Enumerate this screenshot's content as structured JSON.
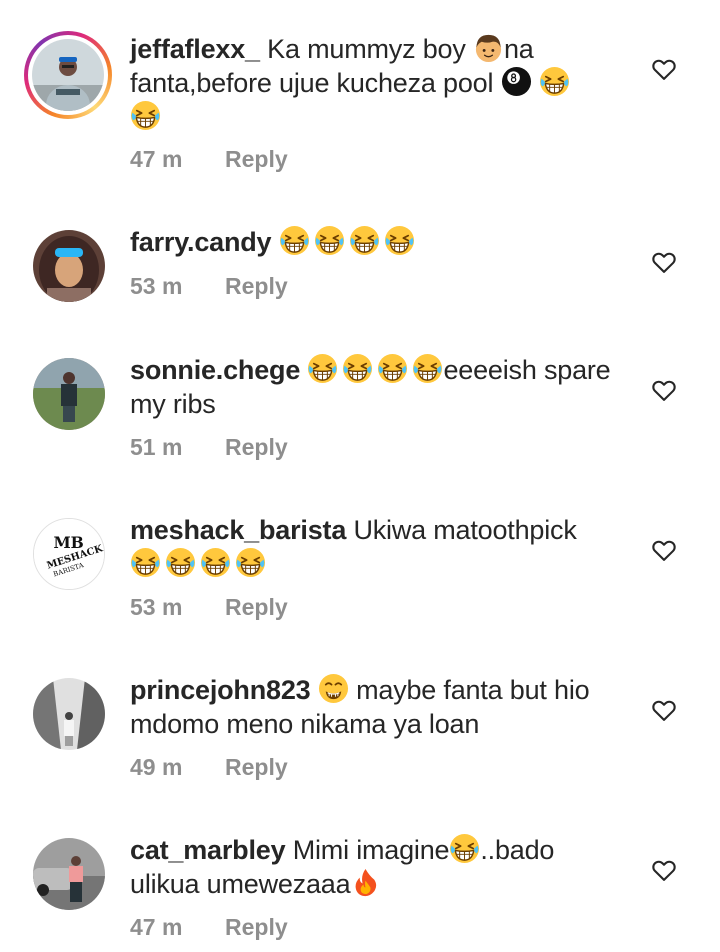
{
  "comments": [
    {
      "username": "jeffaflexx_",
      "text_a": " Ka mummyz  boy ",
      "text_b": "na fanta,before ujue kucheza pool ",
      "time": "47 m",
      "reply_label": "Reply"
    },
    {
      "username": "farry.candy",
      "text_a": " ",
      "time": "53 m",
      "reply_label": "Reply"
    },
    {
      "username": "sonnie.chege",
      "text_a": " ",
      "text_b": "eeeeish spare my ribs",
      "time": "51 m",
      "reply_label": "Reply"
    },
    {
      "username": "meshack_barista",
      "text_a": " Ukiwa matoothpick ",
      "time": "53 m",
      "reply_label": "Reply"
    },
    {
      "username": "princejohn823",
      "text_a": " ",
      "text_b": " maybe fanta but hio mdomo meno nikama ya loan",
      "time": "49 m",
      "reply_label": "Reply"
    },
    {
      "username": "cat_marbley",
      "text_a": " Mimi imagine",
      "text_b": "..bado ulikua umewezaaa",
      "time": "47 m",
      "reply_label": "Reply"
    }
  ],
  "icons": {
    "like": "heart-outline-icon",
    "laugh": "grinning-squinting-face-emoji",
    "boy": "boy-emoji",
    "pool_ball": "pool-8-ball-emoji",
    "money_mouth": "money-mouth-face-emoji",
    "fire": "fire-emoji"
  },
  "colors": {
    "text": "#262626",
    "meta": "#8e8e8e",
    "emoji_yellow": "#FFC83D"
  }
}
